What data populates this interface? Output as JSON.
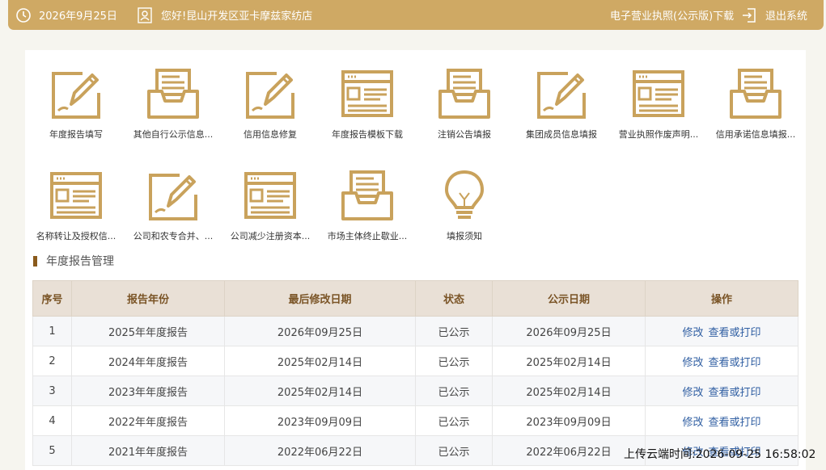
{
  "topbar": {
    "date": "2026年9月25日",
    "greeting": "您好!昆山开发区亚卡摩兹家纺店",
    "license_download": "电子营业执照(公示版)下载",
    "logout": "退出系统"
  },
  "tiles": [
    {
      "label": "年度报告填写",
      "icon": "pencil-doc-icon"
    },
    {
      "label": "其他自行公示信息...",
      "icon": "inbox-tray-icon"
    },
    {
      "label": "信用信息修复",
      "icon": "pencil-doc-icon"
    },
    {
      "label": "年度报告模板下载",
      "icon": "browser-window-icon"
    },
    {
      "label": "注销公告填报",
      "icon": "inbox-tray-icon"
    },
    {
      "label": "集团成员信息填报",
      "icon": "pencil-doc-icon"
    },
    {
      "label": "营业执照作废声明...",
      "icon": "browser-window-icon"
    },
    {
      "label": "信用承诺信息填报...",
      "icon": "inbox-tray-icon"
    },
    {
      "label": "名称转让及授权信...",
      "icon": "browser-window-icon"
    },
    {
      "label": "公司和农专合并、...",
      "icon": "pencil-doc-icon"
    },
    {
      "label": "公司减少注册资本...",
      "icon": "browser-window-icon"
    },
    {
      "label": "市场主体终止歇业...",
      "icon": "inbox-tray-icon"
    },
    {
      "label": "填报须知",
      "icon": "lightbulb-icon"
    }
  ],
  "section": {
    "title": "年度报告管理"
  },
  "table": {
    "headers": [
      "序号",
      "报告年份",
      "最后修改日期",
      "状态",
      "公示日期",
      "操作"
    ],
    "rows": [
      {
        "no": "1",
        "year": "2025年年度报告",
        "modified": "2026年09月25日",
        "status": "已公示",
        "published": "2026年09月25日",
        "edit": "修改",
        "view": "查看或打印"
      },
      {
        "no": "2",
        "year": "2024年年度报告",
        "modified": "2025年02月14日",
        "status": "已公示",
        "published": "2025年02月14日",
        "edit": "修改",
        "view": "查看或打印"
      },
      {
        "no": "3",
        "year": "2023年年度报告",
        "modified": "2025年02月14日",
        "status": "已公示",
        "published": "2025年02月14日",
        "edit": "修改",
        "view": "查看或打印"
      },
      {
        "no": "4",
        "year": "2022年年度报告",
        "modified": "2023年09月09日",
        "status": "已公示",
        "published": "2023年09月09日",
        "edit": "修改",
        "view": "查看或打印"
      },
      {
        "no": "5",
        "year": "2021年年度报告",
        "modified": "2022年06月22日",
        "status": "已公示",
        "published": "2022年06月22日",
        "edit": "修改",
        "view": "查看或打印"
      }
    ]
  },
  "upload_stamp": "上传云端时间:2026-09-25 16:58:02",
  "colors": {
    "accent": "#cfa964",
    "icon": "#c9a25c",
    "link": "#2f5ea2",
    "header_bg": "#e9e0d6"
  }
}
